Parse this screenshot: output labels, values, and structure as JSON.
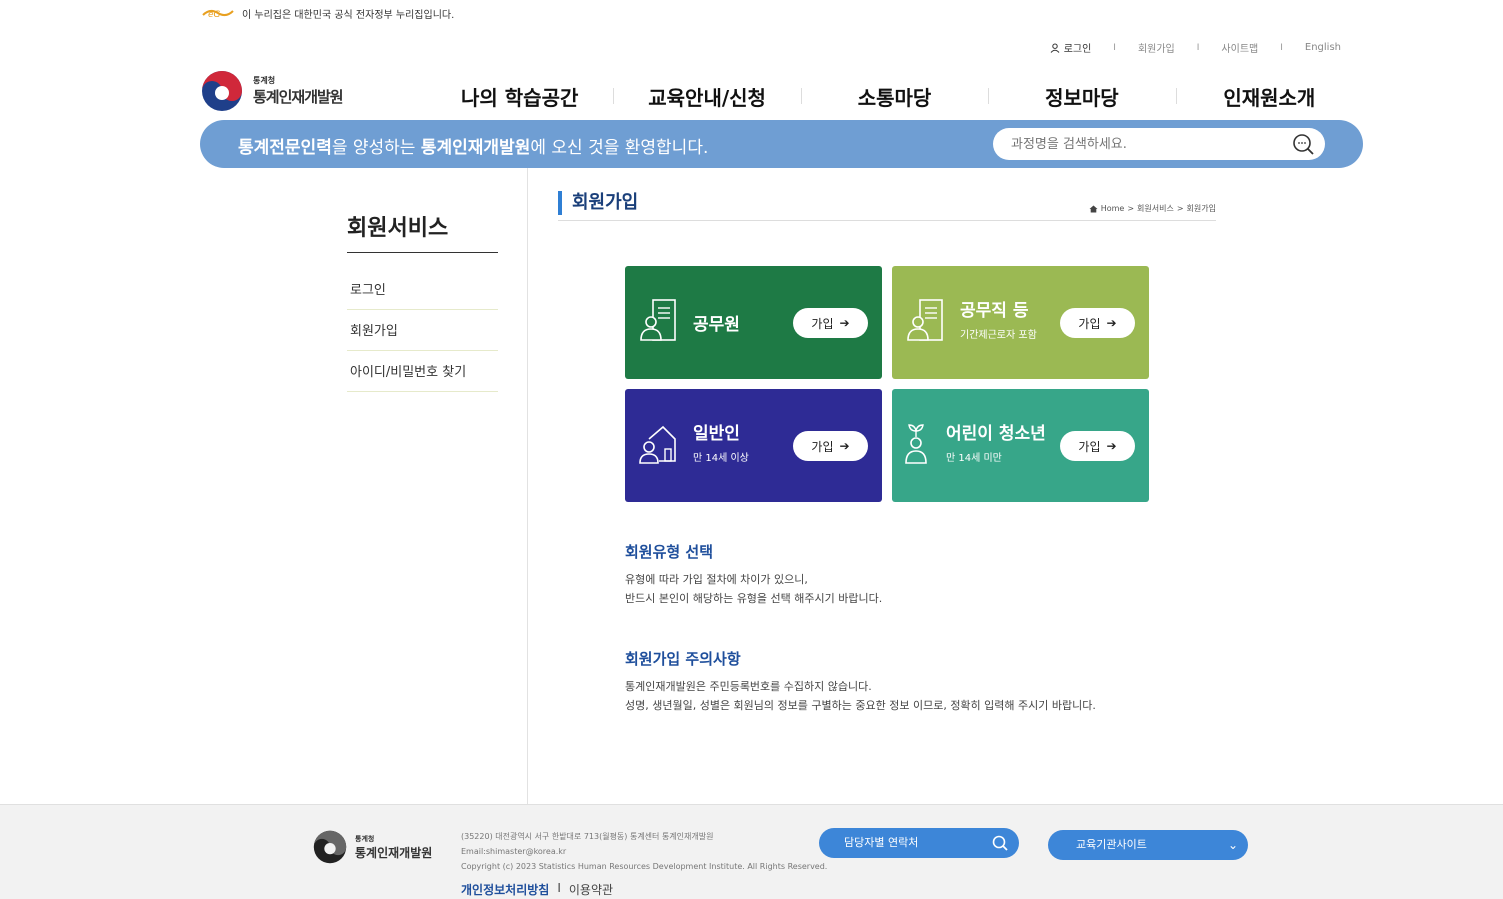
{
  "gov_banner": {
    "text": "이 누리집은 대한민국 공식 전자정부 누리집입니다."
  },
  "util_nav": {
    "login": "로그인",
    "signup": "회원가입",
    "sitemap": "사이트맵",
    "english": "English"
  },
  "logo": {
    "small": "통계청",
    "name": "통계인재개발원"
  },
  "gnb": [
    "나의 학습공간",
    "교육안내/신청",
    "소통마당",
    "정보마당",
    "인재원소개"
  ],
  "welcome": {
    "b1": "통계전문인력",
    "t1": "을 양성하는 ",
    "b2": "통계인재개발원",
    "t2": "에 오신 것을 환영합니다."
  },
  "search": {
    "placeholder": "과정명을 검색하세요."
  },
  "sidebar": {
    "title": "회원서비스",
    "items": [
      "로그인",
      "회원가입",
      "아이디/비밀번호 찾기"
    ]
  },
  "content": {
    "title": "회원가입",
    "breadcrumb": [
      "Home",
      "회원서비스",
      "회원가입"
    ]
  },
  "cards": [
    {
      "name": "공무원",
      "sub": "",
      "button": "가입",
      "color": "#1e7a45"
    },
    {
      "name": "공무직 등",
      "sub": "기간제근로자 포함",
      "button": "가입",
      "color": "#9bb953"
    },
    {
      "name": "일반인",
      "sub": "만 14세 이상",
      "button": "가입",
      "color": "#2e2b95"
    },
    {
      "name": "어린이 청소년",
      "sub": "만 14세 미만",
      "button": "가입",
      "color": "#37a689"
    }
  ],
  "info": [
    {
      "title": "회원유형 선택",
      "lines": [
        "유형에 따라 가입 절차에 차이가 있으니,",
        "반드시 본인이 해당하는 유형을 선택 해주시기 바랍니다."
      ]
    },
    {
      "title": "회원가입 주의사항",
      "lines": [
        "통계인재개발원은 주민등록번호를 수집하지 않습니다.",
        "성명, 생년월일, 성별은 회원님의 정보를 구별하는 중요한 정보 이므로, 정확히 입력해 주시기 바랍니다."
      ]
    }
  ],
  "footer": {
    "address": "(35220) 대전광역시 서구 한밭대로 713(월평동) 통계센터 통계인재개발원",
    "email": "Email:shimaster@korea.kr",
    "copyright": "Copyright (c) 2023 Statistics Human Resources Development Institute. All Rights Reserved.",
    "privacy": "개인정보처리방침",
    "terms": "이용약관",
    "contact_button": "담당자별 연락처",
    "site_select": "교육기관사이트"
  }
}
